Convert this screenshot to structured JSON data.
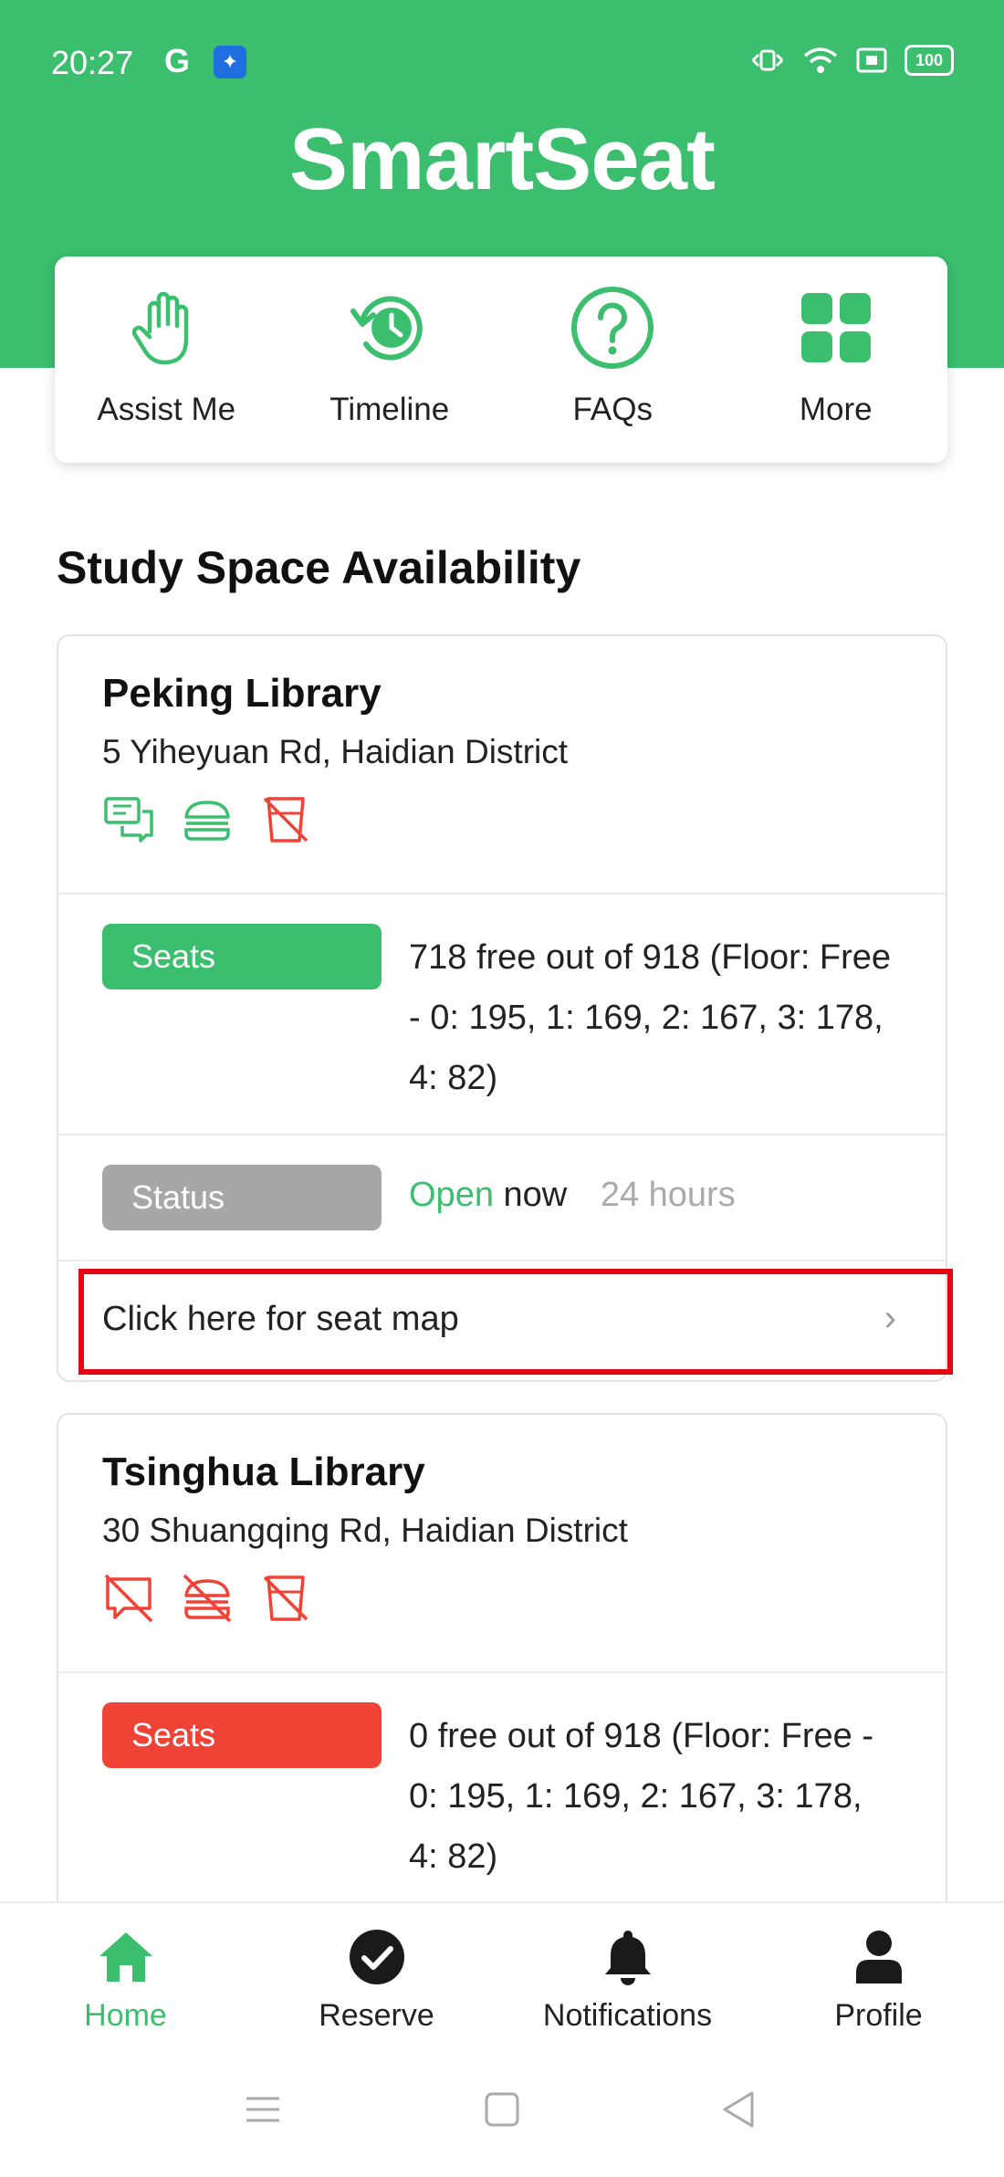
{
  "statusbar": {
    "time": "20:27",
    "g_label": "G",
    "battery": "100"
  },
  "app": {
    "title": "SmartSeat"
  },
  "quick_actions": [
    {
      "label": "Assist Me",
      "icon": "hand-icon"
    },
    {
      "label": "Timeline",
      "icon": "history-icon"
    },
    {
      "label": "FAQs",
      "icon": "question-icon"
    },
    {
      "label": "More",
      "icon": "grid-icon"
    }
  ],
  "section": {
    "title": "Study Space Availability"
  },
  "libraries": [
    {
      "name": "Peking Library",
      "address": "5 Yiheyuan Rd, Haidian District",
      "amenities": [
        "discussion-allowed-icon",
        "food-allowed-icon",
        "drinks-not-allowed-icon"
      ],
      "seats_label": "Seats",
      "seats_text": "718 free out of 918 (Floor: Free - 0: 195, 1: 169, 2: 167, 3: 178, 4: 82)",
      "status_label": "Status",
      "status_open": "Open",
      "status_now": "now",
      "status_hours": "24 hours",
      "map_label": "Click here for seat map",
      "chevron": "›"
    },
    {
      "name": "Tsinghua Library",
      "address": "30 Shuangqing Rd, Haidian District",
      "amenities": [
        "discussion-not-allowed-icon",
        "food-not-allowed-icon",
        "drinks-not-allowed-icon"
      ],
      "seats_label": "Seats",
      "seats_text": "0 free out of 918 (Floor: Free - 0: 195, 1: 169, 2: 167, 3: 178, 4: 82)"
    }
  ],
  "tabs": [
    {
      "label": "Home",
      "icon": "home-icon",
      "active": true
    },
    {
      "label": "Reserve",
      "icon": "check-circle-icon"
    },
    {
      "label": "Notifications",
      "icon": "bell-icon"
    },
    {
      "label": "Profile",
      "icon": "person-icon"
    }
  ],
  "colors": {
    "brand": "#3bbe6e",
    "alert": "#ef4338",
    "muted": "#a7a7a7",
    "highlight": "#e30613"
  }
}
